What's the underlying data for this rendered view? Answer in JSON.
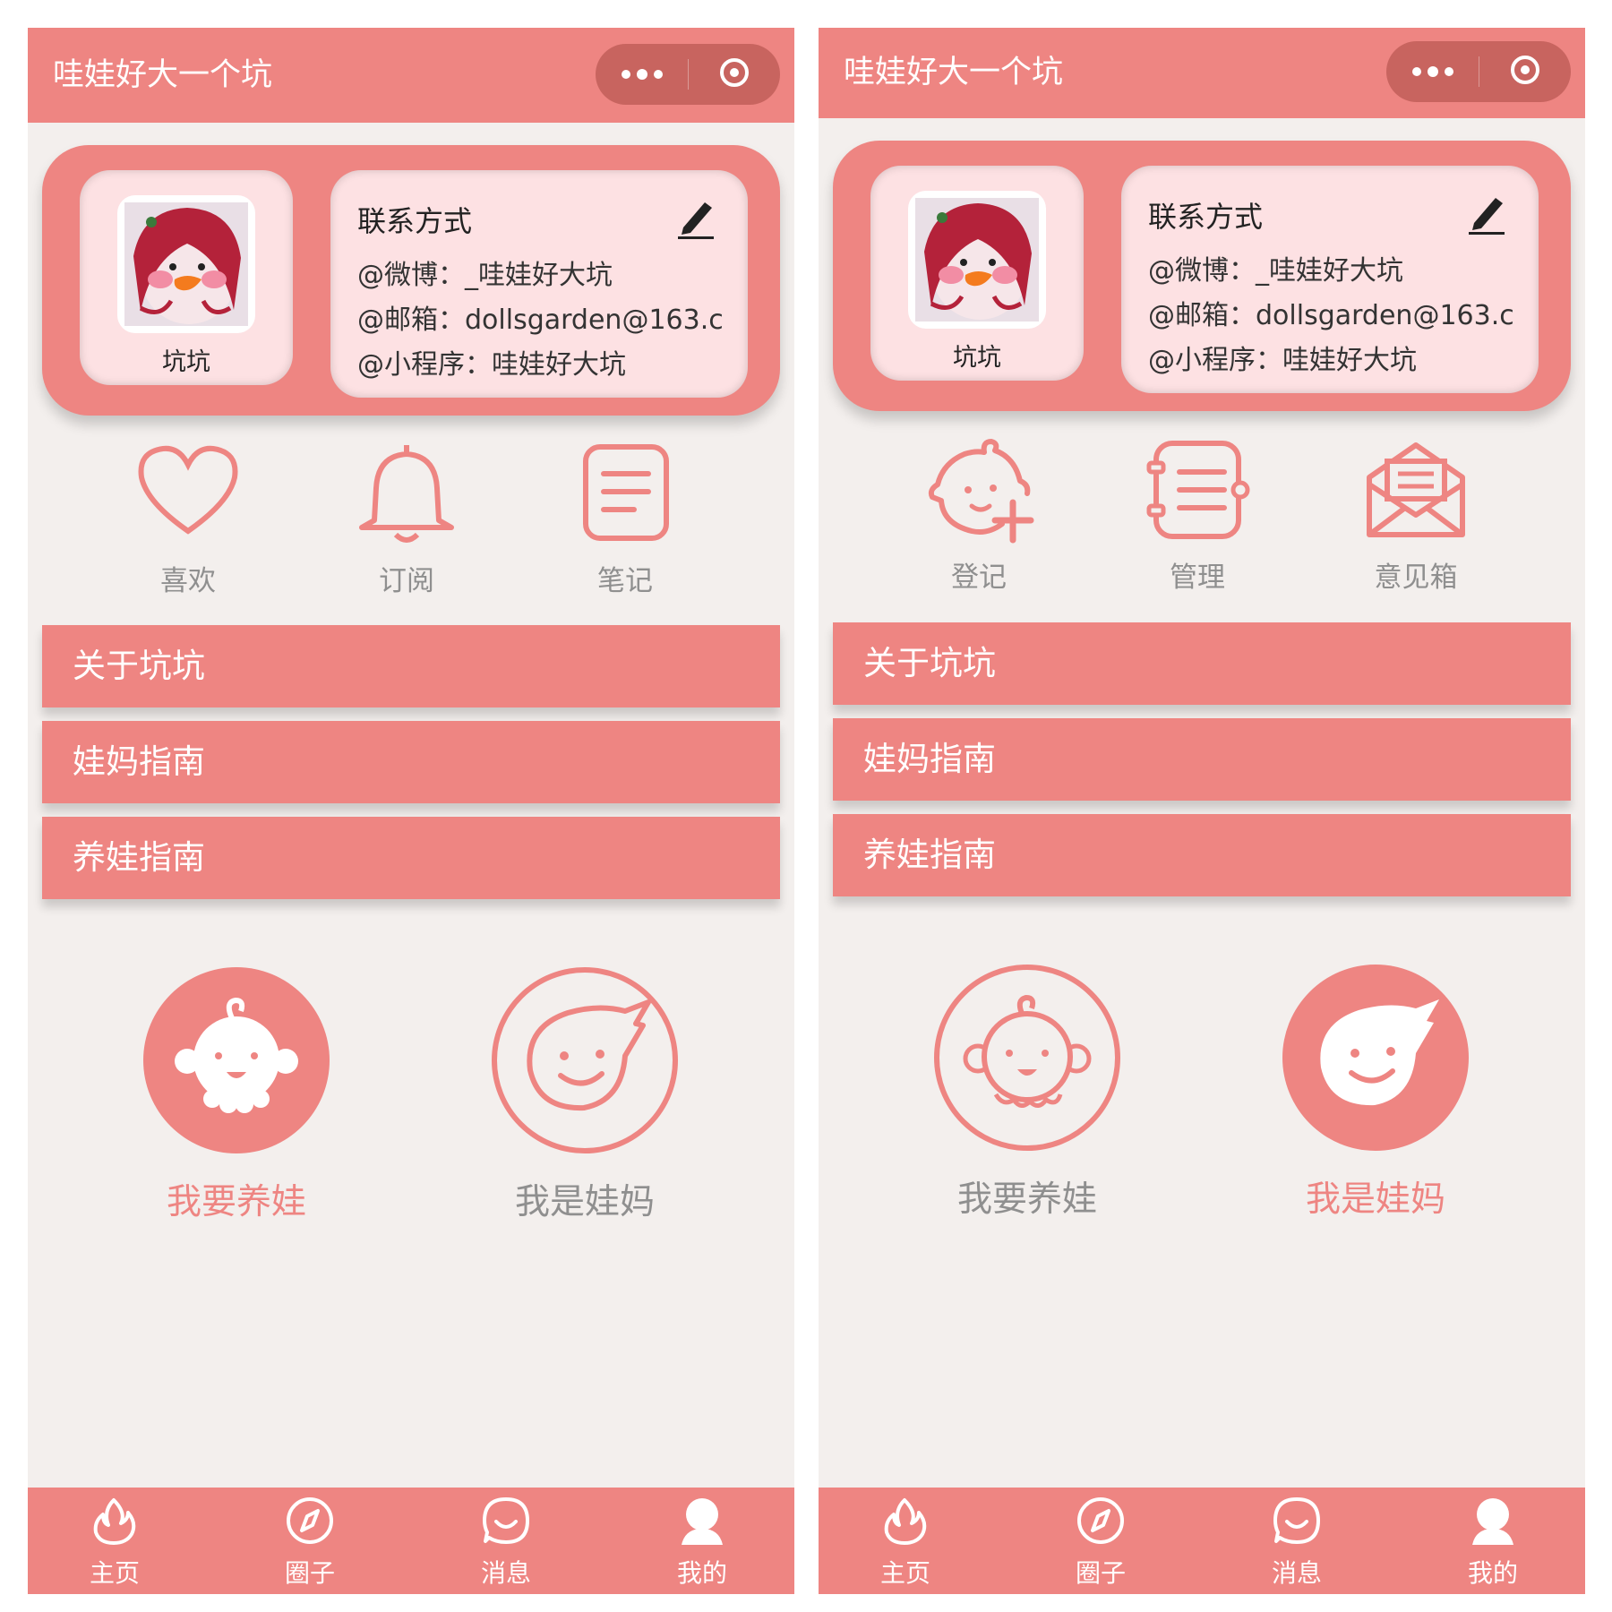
{
  "colors": {
    "accent": "#ee8582",
    "capsule": "#c8645f",
    "panel": "#fde1e3",
    "background": "#f3efed",
    "muted_text": "#8f8f8f"
  },
  "screens": [
    {
      "app_title": "哇娃好大一个坑",
      "profile": {
        "nickname": "坑坑",
        "contact_title": "联系方式",
        "contacts": [
          "@微博：_哇娃好大坑",
          "@邮箱：dollsgarden@163.c",
          "@小程序：哇娃好大坑"
        ]
      },
      "quick_actions": [
        {
          "label": "喜欢",
          "icon": "heart-icon"
        },
        {
          "label": "订阅",
          "icon": "bell-icon"
        },
        {
          "label": "笔记",
          "icon": "notes-icon"
        }
      ],
      "menu": [
        "关于坑坑",
        "娃妈指南",
        "养娃指南"
      ],
      "roles": [
        {
          "label": "我要养娃",
          "icon": "baby-icon",
          "selected": true
        },
        {
          "label": "我是娃妈",
          "icon": "mom-face-icon",
          "selected": false
        }
      ],
      "tabs": [
        {
          "label": "主页",
          "icon": "flame-icon"
        },
        {
          "label": "圈子",
          "icon": "compass-icon"
        },
        {
          "label": "消息",
          "icon": "chat-icon"
        },
        {
          "label": "我的",
          "icon": "user-icon"
        }
      ]
    },
    {
      "app_title": "哇娃好大一个坑",
      "profile": {
        "nickname": "坑坑",
        "contact_title": "联系方式",
        "contacts": [
          "@微博：_哇娃好大坑",
          "@邮箱：dollsgarden@163.c",
          "@小程序：哇娃好大坑"
        ]
      },
      "quick_actions": [
        {
          "label": "登记",
          "icon": "baby-register-icon"
        },
        {
          "label": "管理",
          "icon": "manage-icon"
        },
        {
          "label": "意见箱",
          "icon": "mailbox-icon"
        }
      ],
      "menu": [
        "关于坑坑",
        "娃妈指南",
        "养娃指南"
      ],
      "roles": [
        {
          "label": "我要养娃",
          "icon": "baby-icon",
          "selected": false
        },
        {
          "label": "我是娃妈",
          "icon": "mom-face-icon",
          "selected": true
        }
      ],
      "tabs": [
        {
          "label": "主页",
          "icon": "flame-icon"
        },
        {
          "label": "圈子",
          "icon": "compass-icon"
        },
        {
          "label": "消息",
          "icon": "chat-icon"
        },
        {
          "label": "我的",
          "icon": "user-icon"
        }
      ]
    }
  ]
}
